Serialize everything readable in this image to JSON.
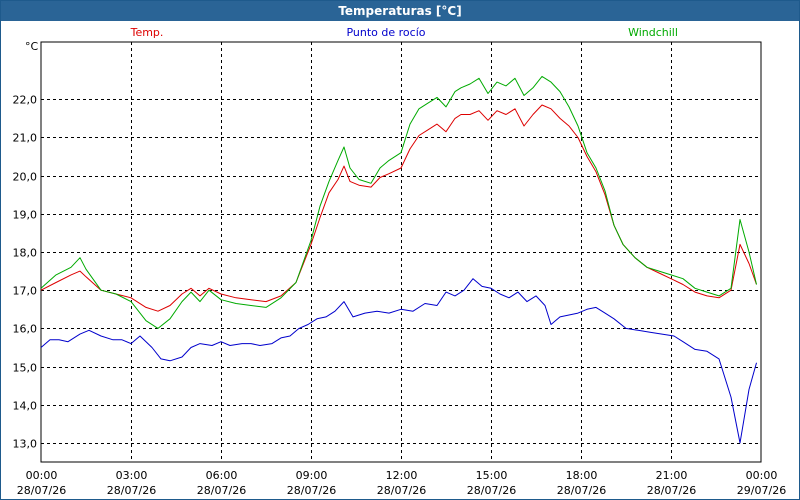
{
  "window": {
    "title": "Temperaturas [°C]"
  },
  "colors": {
    "temp": "#dd0000",
    "dew": "#0000cc",
    "windchill": "#00aa00",
    "grid": "#000000",
    "plot_bg": "#ffffff",
    "title_bg": "#2a6496"
  },
  "chart_data": {
    "type": "line",
    "title": "Temperaturas [°C]",
    "ylabel": "°C",
    "xlabel": "",
    "ylim": [
      12.5,
      23.5
    ],
    "xlim": [
      0,
      24
    ],
    "grid": true,
    "legend_position": "top",
    "yticks": [
      13.0,
      14.0,
      15.0,
      16.0,
      17.0,
      18.0,
      19.0,
      20.0,
      21.0,
      22.0
    ],
    "ytick_labels": [
      "13,0",
      "14,0",
      "15,0",
      "16,0",
      "17,0",
      "18,0",
      "19,0",
      "20,0",
      "21,0",
      "22,0"
    ],
    "xticks": [
      {
        "pos": 0,
        "time": "00:00",
        "date": "28/07/26"
      },
      {
        "pos": 3,
        "time": "03:00",
        "date": "28/07/26"
      },
      {
        "pos": 6,
        "time": "06:00",
        "date": "28/07/26"
      },
      {
        "pos": 9,
        "time": "09:00",
        "date": "28/07/26"
      },
      {
        "pos": 12,
        "time": "12:00",
        "date": "28/07/26"
      },
      {
        "pos": 15,
        "time": "15:00",
        "date": "28/07/26"
      },
      {
        "pos": 18,
        "time": "18:00",
        "date": "28/07/26"
      },
      {
        "pos": 21,
        "time": "21:00",
        "date": "28/07/26"
      },
      {
        "pos": 24,
        "time": "00:00",
        "date": "29/07/26"
      }
    ],
    "series": [
      {
        "name": "Temp.",
        "color": "#dd0000",
        "x": [
          0,
          0.5,
          1,
          1.3,
          1.5,
          2,
          2.5,
          3,
          3.5,
          3.9,
          4.3,
          4.7,
          5,
          5.3,
          5.6,
          6,
          6.5,
          7,
          7.5,
          8,
          8.5,
          9,
          9.3,
          9.6,
          9.9,
          10.1,
          10.3,
          10.6,
          11,
          11.3,
          11.6,
          12,
          12.3,
          12.6,
          12.9,
          13.2,
          13.5,
          13.8,
          14,
          14.3,
          14.6,
          14.9,
          15.2,
          15.5,
          15.8,
          16.1,
          16.4,
          16.7,
          17,
          17.3,
          17.6,
          17.9,
          18.2,
          18.5,
          18.8,
          19.1,
          19.4,
          19.8,
          20.2,
          20.6,
          21,
          21.4,
          21.8,
          22.2,
          22.6,
          23.0,
          23.3,
          23.6,
          23.85
        ],
        "y": [
          17.0,
          17.2,
          17.4,
          17.5,
          17.35,
          17.0,
          16.9,
          16.8,
          16.55,
          16.45,
          16.6,
          16.9,
          17.05,
          16.85,
          17.05,
          16.9,
          16.8,
          16.75,
          16.7,
          16.85,
          17.2,
          18.2,
          18.9,
          19.55,
          19.9,
          20.25,
          19.85,
          19.75,
          19.7,
          19.95,
          20.05,
          20.2,
          20.7,
          21.05,
          21.2,
          21.35,
          21.15,
          21.5,
          21.6,
          21.6,
          21.7,
          21.45,
          21.7,
          21.6,
          21.75,
          21.3,
          21.6,
          21.85,
          21.75,
          21.5,
          21.3,
          21.0,
          20.5,
          20.1,
          19.5,
          18.7,
          18.2,
          17.85,
          17.6,
          17.45,
          17.3,
          17.15,
          16.95,
          16.85,
          16.8,
          17.0,
          18.2,
          17.7,
          17.15
        ]
      },
      {
        "name": "Punto de rocío",
        "color": "#0000cc",
        "x": [
          0,
          0.3,
          0.6,
          0.9,
          1.3,
          1.6,
          2,
          2.4,
          2.7,
          3,
          3.3,
          3.7,
          4,
          4.3,
          4.7,
          5,
          5.3,
          5.7,
          6,
          6.3,
          6.7,
          7,
          7.3,
          7.7,
          8,
          8.3,
          8.6,
          8.9,
          9.2,
          9.5,
          9.8,
          10.1,
          10.4,
          10.8,
          11.2,
          11.6,
          12,
          12.4,
          12.8,
          13.2,
          13.5,
          13.8,
          14.1,
          14.4,
          14.7,
          15,
          15.3,
          15.6,
          15.9,
          16.2,
          16.5,
          16.8,
          17,
          17.3,
          17.6,
          17.9,
          18.2,
          18.5,
          18.8,
          19.1,
          19.5,
          19.9,
          20.3,
          20.7,
          21.1,
          21.4,
          21.8,
          22.2,
          22.6,
          23.0,
          23.3,
          23.6,
          23.85
        ],
        "y": [
          15.5,
          15.7,
          15.7,
          15.65,
          15.85,
          15.95,
          15.8,
          15.7,
          15.7,
          15.6,
          15.8,
          15.5,
          15.2,
          15.15,
          15.25,
          15.5,
          15.6,
          15.55,
          15.65,
          15.55,
          15.6,
          15.6,
          15.55,
          15.6,
          15.75,
          15.8,
          16.0,
          16.1,
          16.25,
          16.3,
          16.45,
          16.7,
          16.3,
          16.4,
          16.45,
          16.4,
          16.5,
          16.45,
          16.65,
          16.6,
          16.95,
          16.85,
          17.0,
          17.3,
          17.1,
          17.05,
          16.9,
          16.8,
          16.95,
          16.7,
          16.85,
          16.6,
          16.1,
          16.3,
          16.35,
          16.4,
          16.5,
          16.55,
          16.4,
          16.25,
          16.0,
          15.95,
          15.9,
          15.85,
          15.8,
          15.65,
          15.45,
          15.4,
          15.2,
          14.2,
          13.0,
          14.4,
          15.1
        ]
      },
      {
        "name": "Windchill",
        "color": "#00aa00",
        "x": [
          0,
          0.5,
          1,
          1.3,
          1.5,
          2,
          2.5,
          3,
          3.5,
          3.9,
          4.3,
          4.7,
          5,
          5.3,
          5.6,
          6,
          6.5,
          7,
          7.5,
          8,
          8.5,
          9,
          9.3,
          9.6,
          9.9,
          10.1,
          10.3,
          10.6,
          11,
          11.3,
          11.6,
          12,
          12.3,
          12.6,
          12.9,
          13.2,
          13.5,
          13.8,
          14,
          14.3,
          14.6,
          14.9,
          15.2,
          15.5,
          15.8,
          16.1,
          16.4,
          16.7,
          17,
          17.3,
          17.6,
          17.9,
          18.2,
          18.5,
          18.8,
          19.1,
          19.4,
          19.8,
          20.2,
          20.6,
          21,
          21.4,
          21.8,
          22.2,
          22.6,
          23.0,
          23.3,
          23.6,
          23.85
        ],
        "y": [
          17.05,
          17.4,
          17.6,
          17.85,
          17.55,
          17.0,
          16.9,
          16.7,
          16.2,
          16.0,
          16.25,
          16.7,
          16.95,
          16.7,
          17.0,
          16.75,
          16.65,
          16.6,
          16.55,
          16.8,
          17.2,
          18.3,
          19.2,
          19.85,
          20.4,
          20.75,
          20.2,
          19.9,
          19.8,
          20.2,
          20.4,
          20.6,
          21.35,
          21.75,
          21.9,
          22.05,
          21.8,
          22.2,
          22.3,
          22.4,
          22.55,
          22.15,
          22.45,
          22.35,
          22.55,
          22.1,
          22.3,
          22.6,
          22.45,
          22.2,
          21.8,
          21.3,
          20.6,
          20.2,
          19.6,
          18.7,
          18.2,
          17.85,
          17.6,
          17.5,
          17.4,
          17.3,
          17.05,
          16.95,
          16.85,
          17.05,
          18.85,
          18.0,
          17.15
        ]
      }
    ]
  }
}
